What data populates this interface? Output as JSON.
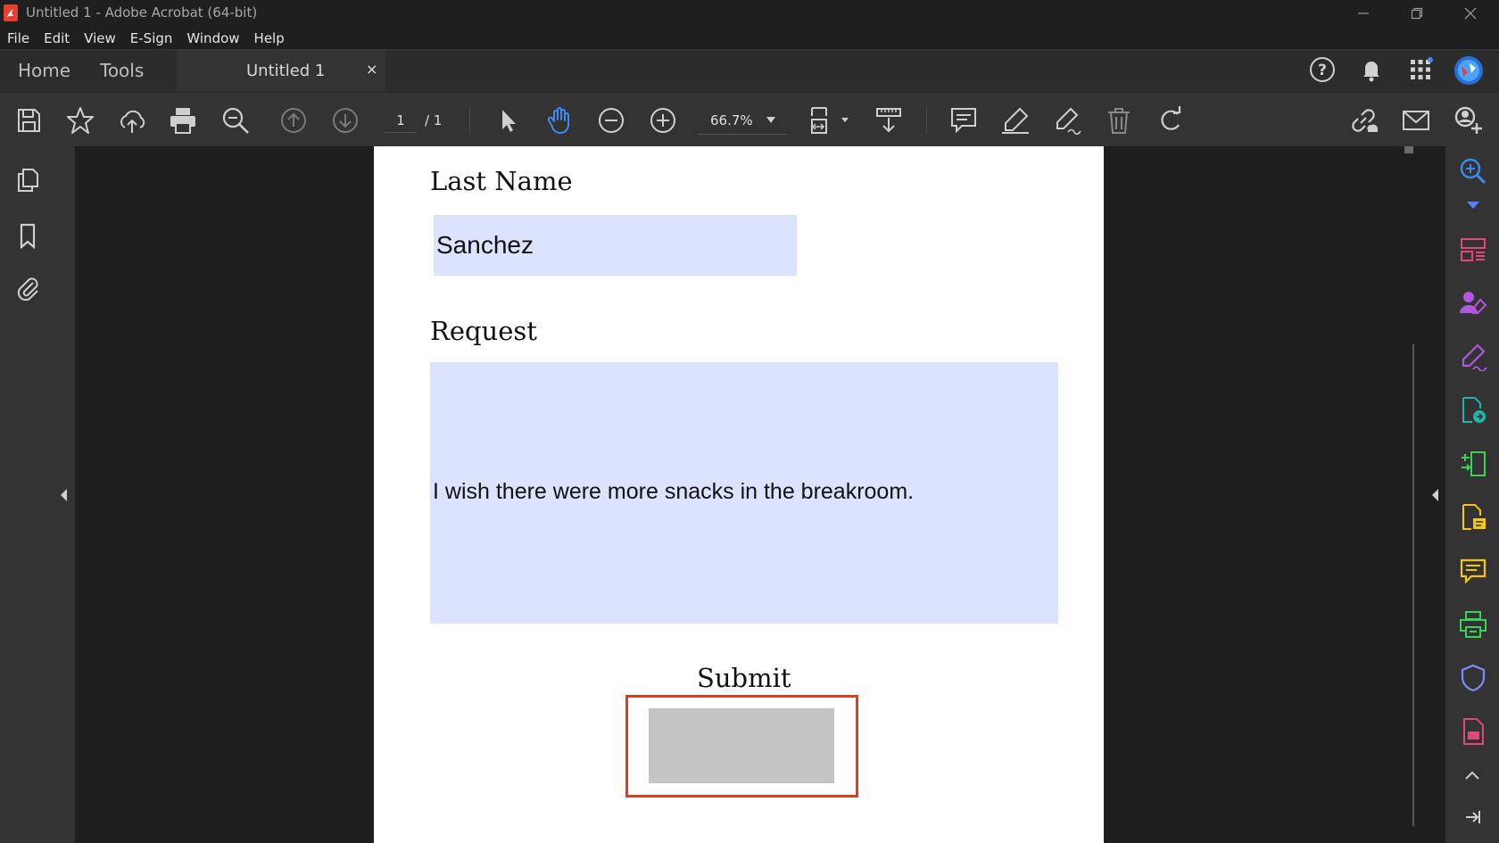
{
  "window": {
    "title": "Untitled 1 - Adobe Acrobat (64-bit)"
  },
  "menu": [
    "File",
    "Edit",
    "View",
    "E-Sign",
    "Window",
    "Help"
  ],
  "tabs": {
    "home": "Home",
    "tools": "Tools",
    "document": "Untitled 1",
    "close_glyph": "×"
  },
  "toolbar": {
    "page_current": "1",
    "page_total": "/ 1",
    "zoom": "66.7%"
  },
  "form": {
    "last_name_label": "Last Name",
    "last_name_value": "Sanchez",
    "request_label": "Request",
    "request_value": "I wish there were more snacks in the breakroom.",
    "submit_label": "Submit"
  },
  "colors": {
    "field_bg": "#dce3ff",
    "highlight_border": "#e53a1e",
    "active_tool": "#3d8bf2"
  },
  "icons": {
    "left_panel": [
      "pages-icon",
      "bookmark-icon",
      "attachment-icon"
    ],
    "right_panel": [
      "zoom-search-icon",
      "organize-icon",
      "request-signature-icon",
      "fill-sign-icon",
      "export-pdf-icon",
      "edit-pdf-icon",
      "create-pdf-icon",
      "comment-icon",
      "print-production-icon",
      "protect-icon",
      "more-tools-icon"
    ]
  }
}
